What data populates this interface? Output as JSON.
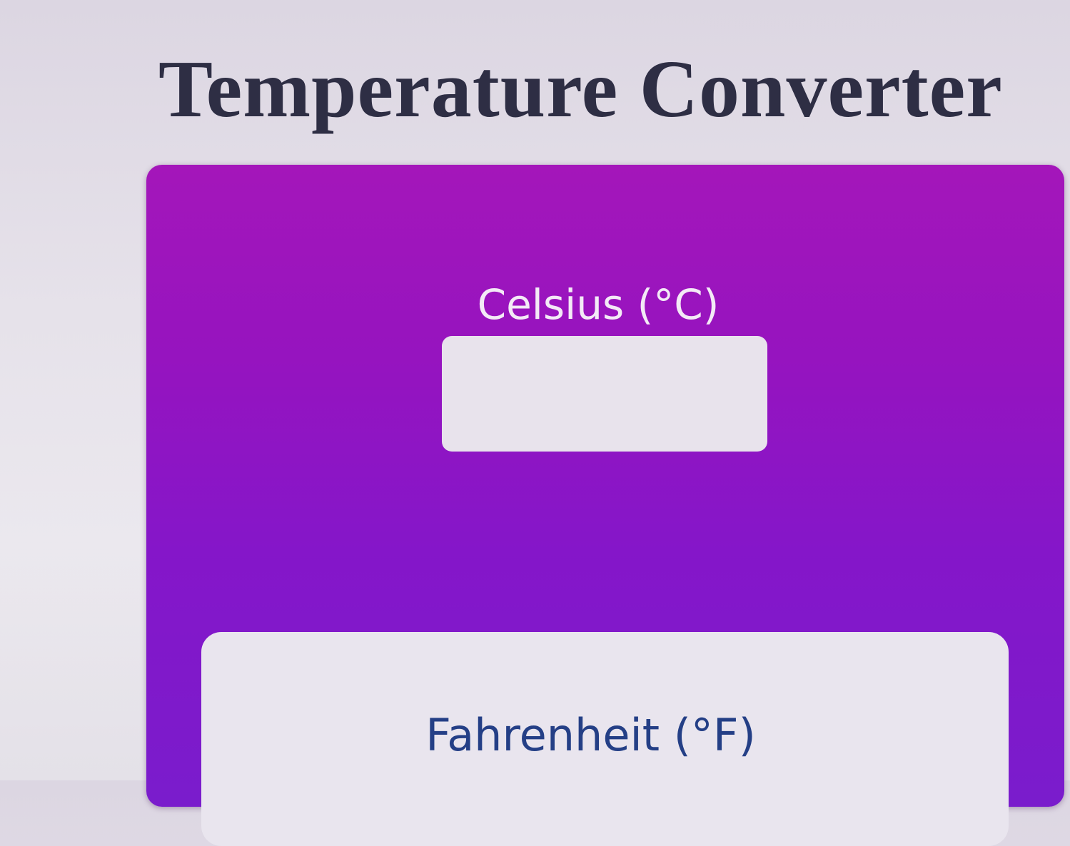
{
  "page": {
    "title": "Temperature Converter"
  },
  "converter": {
    "celsius": {
      "label": "Celsius (°C)",
      "value": ""
    },
    "fahrenheit": {
      "label": "Fahrenheit (°F)"
    }
  },
  "colors": {
    "title_text": "#2e2e44",
    "card_gradient_top": "#a416ba",
    "card_gradient_bottom": "#7a1ccc",
    "input_background": "#e8e3ec",
    "fahrenheit_text": "#243f86"
  }
}
